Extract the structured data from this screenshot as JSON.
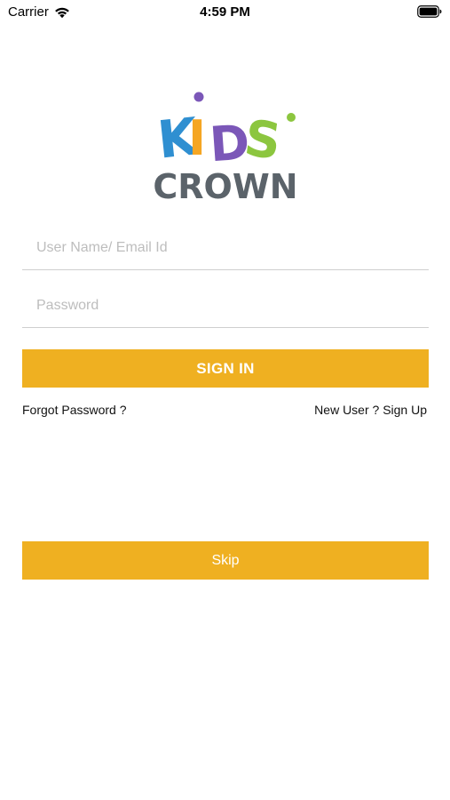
{
  "status_bar": {
    "carrier": "Carrier",
    "time": "4:59 PM"
  },
  "logo": {
    "line1": "KIDS",
    "line2": "CROWN",
    "colors": {
      "k": "#2f8fd1",
      "i": "#f5a623",
      "d": "#7b57b8",
      "s": "#8cc63f",
      "dot_top": "#7b57b8",
      "dot_right": "#8cc63f",
      "crown_text": "#5b636a"
    }
  },
  "form": {
    "username_placeholder": "User Name/ Email Id",
    "password_placeholder": "Password",
    "signin_label": "SIGN IN",
    "forgot_label": "Forgot Password ?",
    "signup_label": "New User ? Sign Up",
    "skip_label": "Skip"
  },
  "colors": {
    "accent": "#efb021",
    "divider": "#cfcfcf",
    "placeholder": "#bdbdbd"
  }
}
